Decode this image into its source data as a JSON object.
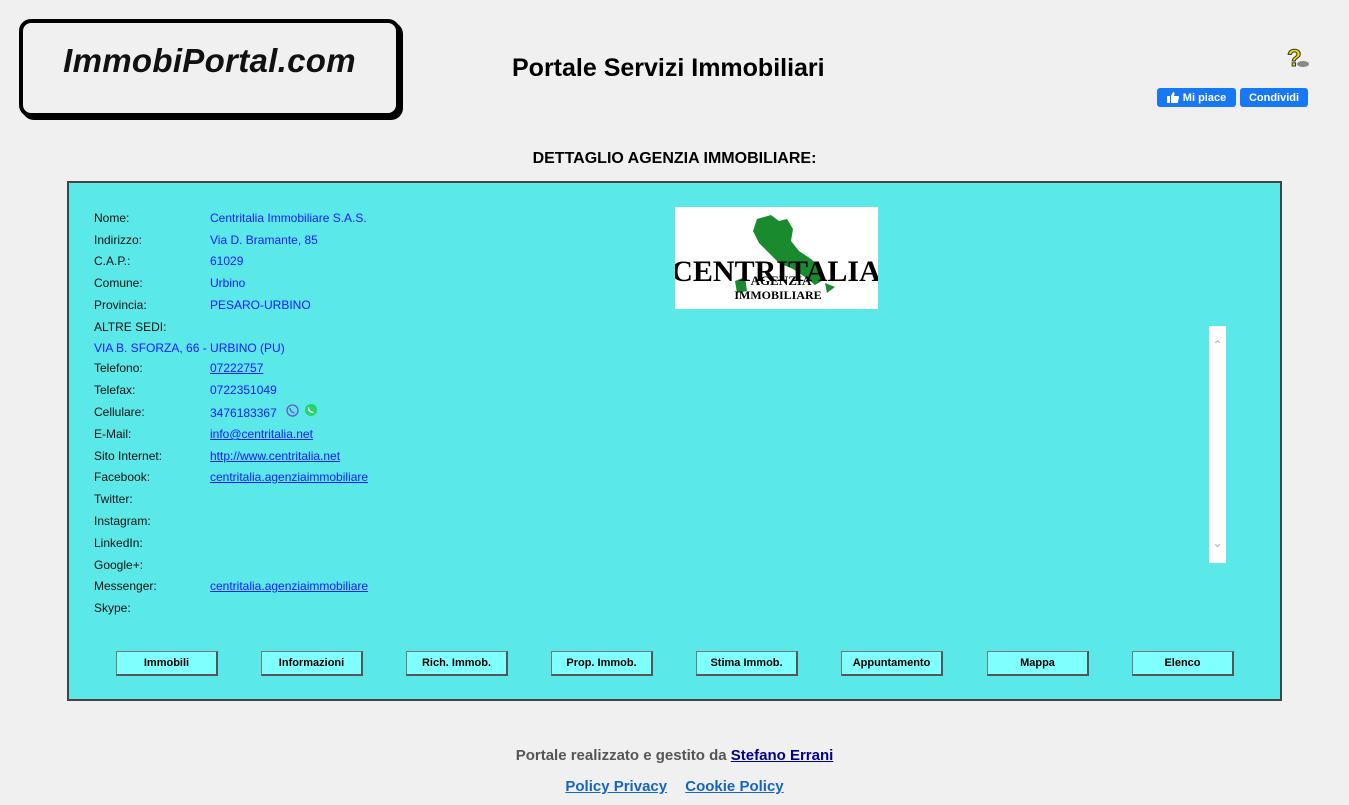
{
  "site": {
    "logo_text": "ImmobiPortal.com",
    "title": "Portale Servizi Immobiliari",
    "help_icon": "question-mark-icon",
    "fb_like": "Mi piace",
    "fb_share": "Condividi"
  },
  "section_title": "DETTAGLIO AGENZIA IMMOBILIARE:",
  "agency": {
    "logo_text": "CENTRITALIA",
    "logo_sub1": "AGENZIA",
    "logo_sub2": "IMMOBILIARE",
    "rows": [
      {
        "label": "Nome:",
        "value": "Centritalia Immobiliare S.A.S."
      },
      {
        "label": "Indirizzo:",
        "value": "Via D. Bramante, 85"
      },
      {
        "label": "C.A.P.:",
        "value": "61029"
      },
      {
        "label": "Comune:",
        "value": "Urbino"
      },
      {
        "label": "Provincia:",
        "value": "PESARO-URBINO"
      },
      {
        "label": "ALTRE SEDI:",
        "value": ""
      }
    ],
    "sede": "VIA B. SFORZA, 66 - URBINO (PU)",
    "contacts": [
      {
        "label": "Telefono:",
        "value": "07222757"
      },
      {
        "label": "Telefax:",
        "value": "0722351049"
      },
      {
        "label": "Cellulare:",
        "value": "3476183367"
      },
      {
        "label": "E-Mail:",
        "value": "info@centritalia.net"
      },
      {
        "label": "Sito Internet:",
        "value": "http://www.centritalia.net"
      },
      {
        "label": "Facebook:",
        "value": "centritalia.agenziaimmobiliare"
      },
      {
        "label": "Twitter:",
        "value": ""
      },
      {
        "label": "Instagram:",
        "value": ""
      },
      {
        "label": "LinkedIn:",
        "value": ""
      },
      {
        "label": "Google+:",
        "value": ""
      },
      {
        "label": "Messenger:",
        "value": "centritalia.agenziaimmobiliare"
      },
      {
        "label": "Skype:",
        "value": ""
      }
    ]
  },
  "buttons": [
    "Immobili",
    "Informazioni",
    "Rich. Immob.",
    "Prop. Immob.",
    "Stima Immob.",
    "Appuntamento",
    "Mappa",
    "Elenco"
  ],
  "footer": {
    "credit_prefix": "Portale realizzato e gestito da",
    "credit_name": "Stefano Errani",
    "privacy": "Policy Privacy",
    "cookie": "Cookie Policy"
  },
  "colors": {
    "panel": "#5ae8e8",
    "button": "#80ffff",
    "link": "#1a1aff",
    "facebook": "#1877f2"
  }
}
